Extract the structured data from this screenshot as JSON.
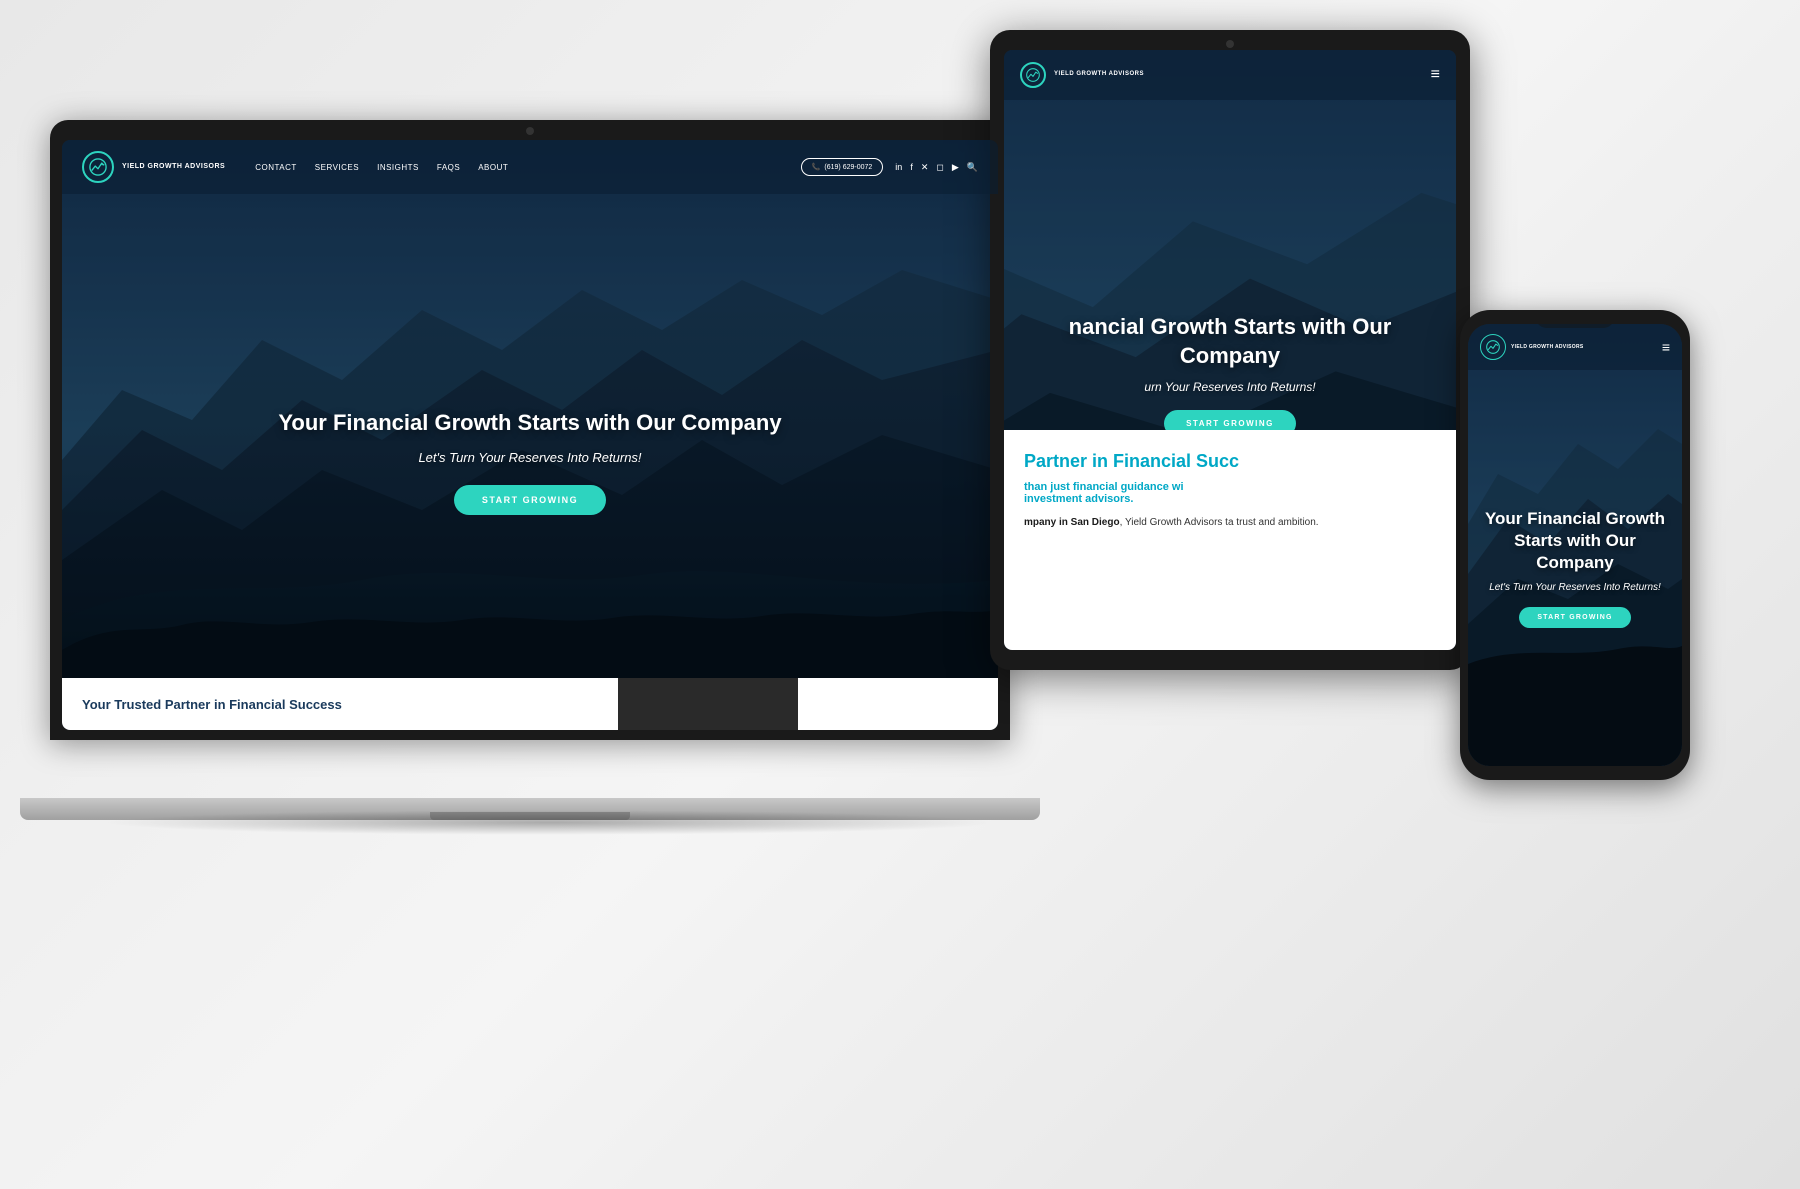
{
  "scene": {
    "background_color": "#f0f0f0"
  },
  "brand": {
    "name": "YIELD GROWTH ADVISORS",
    "name_line1": "YIELD",
    "name_line2": "GROWTH",
    "name_line3": "ADVISORS",
    "phone": "(619) 629-0072",
    "accent_color": "#2dd4bf"
  },
  "nav": {
    "links": [
      "CONTACT",
      "SERVICES",
      "INSIGHTS",
      "FAQS",
      "ABOUT"
    ],
    "phone_label": "(619) 629-0072"
  },
  "hero": {
    "title": "Your Financial Growth Starts with Our Company",
    "subtitle": "Let's Turn Your Reserves Into Returns!",
    "cta_label": "START GROWING"
  },
  "footer": {
    "title": "Your Trusted Partner in Financial Success"
  },
  "tablet": {
    "hero_title": "nancial Growth Starts with Our Company",
    "hero_subtitle": "urn Your Reserves Into Returns!",
    "cta_label": "START GROWING",
    "lower_title": "Partner in Financial Succ",
    "lower_subtitle": "than just financial guidance wi investment advisors.",
    "lower_text": "mpany in San Diego, Yield Growth Advisors ta trust and ambition."
  },
  "phone": {
    "hero_title": "Your Financial Growth Starts with Our Company",
    "hero_subtitle": "Let's Turn Your Reserves Into Returns!",
    "cta_label": "START GROWING"
  }
}
